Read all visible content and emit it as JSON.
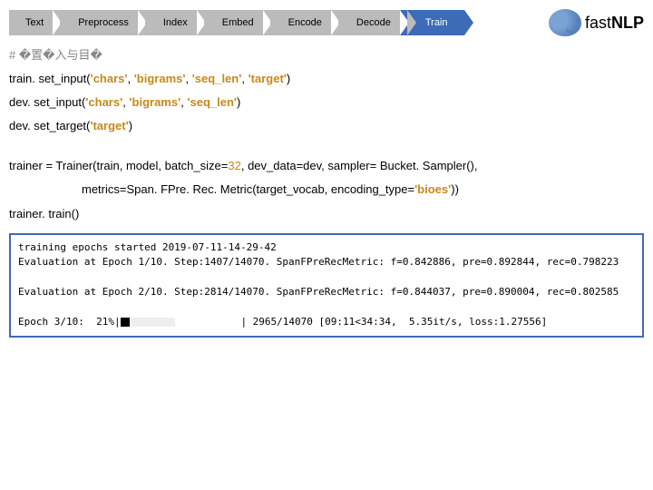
{
  "steps": {
    "s1": "Text",
    "s2": "Preprocess",
    "s3": "Index",
    "s4": "Embed",
    "s5": "Encode",
    "s6": "Decode",
    "s7": "Train"
  },
  "logo": {
    "fast": "fast",
    "nlp": "NLP"
  },
  "code": {
    "comment": "# �置�入与目�",
    "l1a": "train. set_input(",
    "l1s1": "'chars'",
    "l1c1": ", ",
    "l1s2": "'bigrams'",
    "l1c2": ", ",
    "l1s3": "'seq_len'",
    "l1c3": ", ",
    "l1s4": "'target'",
    "l1e": ")",
    "l2a": "dev. set_input(",
    "l2s1": "'chars'",
    "l2c1": ", ",
    "l2s2": "'bigrams'",
    "l2c2": ", ",
    "l2s3": "'seq_len'",
    "l2e": ")",
    "l3a": "dev. set_target(",
    "l3s1": "'target'",
    "l3e": ")",
    "l4a": "trainer = Trainer(train, model, ",
    "l4b": "batch_size",
    "l4c": "=",
    "l4n": "32",
    "l4d": ", ",
    "l4e": "dev_data",
    "l4f": "=dev, ",
    "l4g": "sampler",
    "l4h": "= Bucket. Sampler(),",
    "l5a": "metrics",
    "l5b": "=Span. FPre. Rec. Metric(target_vocab, ",
    "l5c": "encoding_type",
    "l5d": "=",
    "l5s": "'bioes'",
    "l5e": "))",
    "l6": "trainer. train()"
  },
  "console": {
    "l1": "training epochs started 2019-07-11-14-29-42",
    "l2": "Evaluation at Epoch 1/10. Step:1407/14070. SpanFPreRecMetric: f=0.842886, pre=0.892844, rec=0.798223",
    "l3": "",
    "l4": "Evaluation at Epoch 2/10. Step:2814/14070. SpanFPreRecMetric: f=0.844037, pre=0.890004, rec=0.802585",
    "l5": "",
    "l6a": "Epoch 3/10:  21%|",
    "l6b": "           | 2965/14070 [09:11<34:34,  5.35it/s, loss:1.27556]"
  }
}
